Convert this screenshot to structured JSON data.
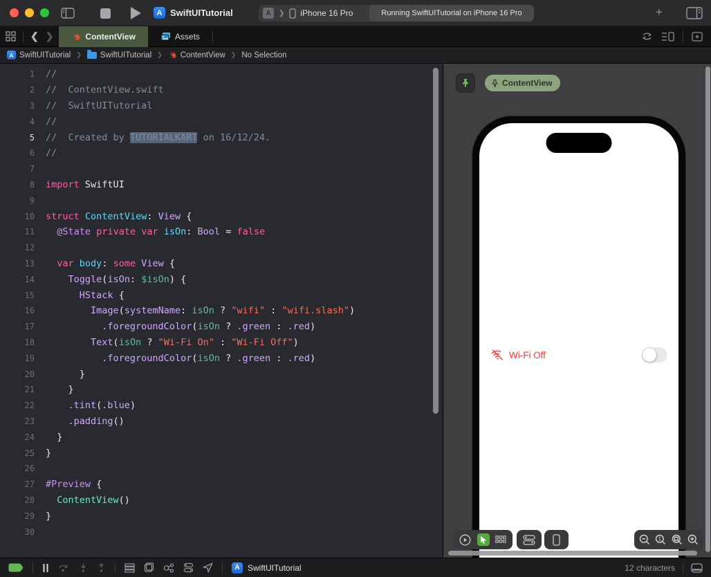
{
  "titlebar": {
    "window_title": "SwiftUITutorial",
    "scheme_device": "iPhone 16 Pro",
    "status_message": "Running SwiftUITutorial on iPhone 16 Pro",
    "app_icon_letter": "A"
  },
  "tabs": [
    {
      "label": "ContentView",
      "icon": "swift",
      "active": true
    },
    {
      "label": "Assets",
      "icon": "photos",
      "active": false
    }
  ],
  "breadcrumb": {
    "items": [
      {
        "label": "SwiftUITutorial",
        "icon": "app"
      },
      {
        "label": "SwiftUITutorial",
        "icon": "folder"
      },
      {
        "label": "ContentView",
        "icon": "swift"
      },
      {
        "label": "No Selection",
        "icon": "none"
      }
    ]
  },
  "editor": {
    "palette": {
      "pl": "#e8e8e9",
      "cm": "#7f8c98",
      "kw": "#fc5fa3",
      "ty": "#d0a8ff",
      "att": "#ce8ef5",
      "decl": "#5dd8ff",
      "ref": "#67b7a4",
      "proj": "#72e4c5",
      "str": "#fc6a5d"
    },
    "selection_bg": "#56647b",
    "lines": [
      {
        "n": 1,
        "seg": [
          [
            "//",
            "cm"
          ]
        ]
      },
      {
        "n": 2,
        "seg": [
          [
            "//  ContentView.swift",
            "cm"
          ]
        ]
      },
      {
        "n": 3,
        "seg": [
          [
            "//  SwiftUITutorial",
            "cm"
          ]
        ]
      },
      {
        "n": 4,
        "seg": [
          [
            "//",
            "cm"
          ]
        ]
      },
      {
        "n": 5,
        "current": true,
        "seg": [
          [
            "//  Created by ",
            "cm"
          ],
          [
            "TUTORIALKART",
            "sel"
          ],
          [
            " on 16/12/24.",
            "cm"
          ]
        ]
      },
      {
        "n": 6,
        "seg": [
          [
            "//",
            "cm"
          ]
        ]
      },
      {
        "n": 7,
        "seg": []
      },
      {
        "n": 8,
        "seg": [
          [
            "import",
            "kw"
          ],
          [
            " ",
            "pl"
          ],
          [
            "SwiftUI",
            "pl"
          ]
        ]
      },
      {
        "n": 9,
        "seg": []
      },
      {
        "n": 10,
        "seg": [
          [
            "struct",
            "kw"
          ],
          [
            " ",
            "pl"
          ],
          [
            "ContentView",
            "decl"
          ],
          [
            ": ",
            "pl"
          ],
          [
            "View",
            "ty"
          ],
          [
            " {",
            "pl"
          ]
        ]
      },
      {
        "n": 11,
        "seg": [
          [
            "  ",
            "pl"
          ],
          [
            "@State",
            "att"
          ],
          [
            " ",
            "pl"
          ],
          [
            "private",
            "kw"
          ],
          [
            " ",
            "pl"
          ],
          [
            "var",
            "kw"
          ],
          [
            " ",
            "pl"
          ],
          [
            "isOn",
            "decl"
          ],
          [
            ": ",
            "pl"
          ],
          [
            "Bool",
            "ty"
          ],
          [
            " = ",
            "pl"
          ],
          [
            "false",
            "kw"
          ]
        ]
      },
      {
        "n": 12,
        "seg": []
      },
      {
        "n": 13,
        "seg": [
          [
            "  ",
            "pl"
          ],
          [
            "var",
            "kw"
          ],
          [
            " ",
            "pl"
          ],
          [
            "body",
            "decl"
          ],
          [
            ": ",
            "pl"
          ],
          [
            "some",
            "kw"
          ],
          [
            " ",
            "pl"
          ],
          [
            "View",
            "ty"
          ],
          [
            " {",
            "pl"
          ]
        ]
      },
      {
        "n": 14,
        "seg": [
          [
            "    ",
            "pl"
          ],
          [
            "Toggle",
            "ty"
          ],
          [
            "(",
            "pl"
          ],
          [
            "isOn",
            "ty"
          ],
          [
            ": ",
            "pl"
          ],
          [
            "$isOn",
            "ref"
          ],
          [
            ") {",
            "pl"
          ]
        ]
      },
      {
        "n": 15,
        "seg": [
          [
            "      ",
            "pl"
          ],
          [
            "HStack",
            "ty"
          ],
          [
            " {",
            "pl"
          ]
        ]
      },
      {
        "n": 16,
        "seg": [
          [
            "        ",
            "pl"
          ],
          [
            "Image",
            "ty"
          ],
          [
            "(",
            "pl"
          ],
          [
            "systemName",
            "ty"
          ],
          [
            ": ",
            "pl"
          ],
          [
            "isOn",
            "ref"
          ],
          [
            " ? ",
            "pl"
          ],
          [
            "\"wifi\"",
            "str"
          ],
          [
            " : ",
            "pl"
          ],
          [
            "\"wifi.slash\"",
            "str"
          ],
          [
            ")",
            "pl"
          ]
        ]
      },
      {
        "n": 17,
        "seg": [
          [
            "          ",
            "pl"
          ],
          [
            ".foregroundColor",
            "ty"
          ],
          [
            "(",
            "pl"
          ],
          [
            "isOn",
            "ref"
          ],
          [
            " ? ",
            "pl"
          ],
          [
            ".green",
            "ty"
          ],
          [
            " : ",
            "pl"
          ],
          [
            ".red",
            "ty"
          ],
          [
            ")",
            "pl"
          ]
        ]
      },
      {
        "n": 18,
        "seg": [
          [
            "        ",
            "pl"
          ],
          [
            "Text",
            "ty"
          ],
          [
            "(",
            "pl"
          ],
          [
            "isOn",
            "ref"
          ],
          [
            " ? ",
            "pl"
          ],
          [
            "\"Wi-Fi On\"",
            "str"
          ],
          [
            " : ",
            "pl"
          ],
          [
            "\"Wi-Fi Off\"",
            "str"
          ],
          [
            ")",
            "pl"
          ]
        ]
      },
      {
        "n": 19,
        "seg": [
          [
            "          ",
            "pl"
          ],
          [
            ".foregroundColor",
            "ty"
          ],
          [
            "(",
            "pl"
          ],
          [
            "isOn",
            "ref"
          ],
          [
            " ? ",
            "pl"
          ],
          [
            ".green",
            "ty"
          ],
          [
            " : ",
            "pl"
          ],
          [
            ".red",
            "ty"
          ],
          [
            ")",
            "pl"
          ]
        ]
      },
      {
        "n": 20,
        "seg": [
          [
            "      }",
            "pl"
          ]
        ]
      },
      {
        "n": 21,
        "seg": [
          [
            "    }",
            "pl"
          ]
        ]
      },
      {
        "n": 22,
        "seg": [
          [
            "    ",
            "pl"
          ],
          [
            ".tint",
            "ty"
          ],
          [
            "(",
            "pl"
          ],
          [
            ".blue",
            "ty"
          ],
          [
            ")",
            "pl"
          ]
        ]
      },
      {
        "n": 23,
        "seg": [
          [
            "    ",
            "pl"
          ],
          [
            ".padding",
            "ty"
          ],
          [
            "()",
            "pl"
          ]
        ]
      },
      {
        "n": 24,
        "seg": [
          [
            "  }",
            "pl"
          ]
        ]
      },
      {
        "n": 25,
        "seg": [
          [
            "}",
            "pl"
          ]
        ]
      },
      {
        "n": 26,
        "seg": []
      },
      {
        "n": 27,
        "seg": [
          [
            "#Preview",
            "att"
          ],
          [
            " {",
            "pl"
          ]
        ]
      },
      {
        "n": 28,
        "seg": [
          [
            "  ",
            "pl"
          ],
          [
            "ContentView",
            "proj"
          ],
          [
            "()",
            "pl"
          ]
        ]
      },
      {
        "n": 29,
        "seg": [
          [
            "}",
            "pl"
          ]
        ]
      },
      {
        "n": 30,
        "seg": []
      }
    ]
  },
  "preview": {
    "badge_label": "ContentView",
    "accent_green": "#58a942",
    "pin_green": "#6bbf59",
    "phone": {
      "wifi_label": "Wi-Fi Off",
      "wifi_color": "#ff3b30",
      "toggle_on": false
    }
  },
  "statusbar": {
    "project_label": "SwiftUITutorial",
    "character_count": "12 characters"
  }
}
